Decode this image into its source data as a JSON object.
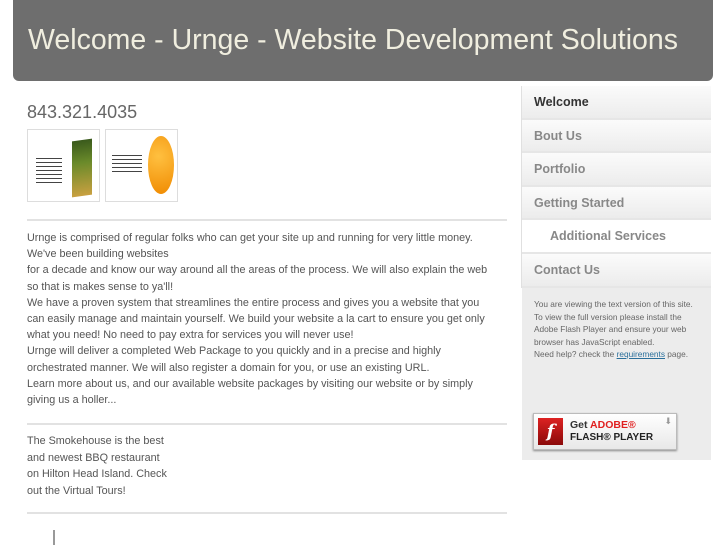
{
  "header": {
    "title": "Welcome - Urnge - Website Development Solutions"
  },
  "main": {
    "phone": "843.321.4035",
    "intro_lines": [
      "Urnge is comprised of regular folks who can get your site up and running for very little money.",
      "We've been building websites",
      "for a decade and know our way around all the areas of the process. We will also explain the web",
      "so that is makes sense to ya'll!",
      "We have a proven system that streamlines the entire process and gives you a website that you",
      "can easily manage and maintain yourself. We build your website a la cart to ensure you get only",
      "what you need! No need to pay extra for services you will never use!",
      "Urnge will deliver a completed Web Package to you quickly and in a precise and highly",
      "orchestrated manner. We will also register a domain for you, or use an existing URL.",
      "Learn more about us, and our available website packages by visiting our website or by simply",
      "giving us a holler..."
    ],
    "smokehouse_lines": [
      "The Smokehouse is the best",
      "and newest BBQ restaurant",
      "on Hilton Head Island. Check",
      "out the Virtual Tours!"
    ]
  },
  "nav": {
    "items": [
      {
        "label": "Welcome"
      },
      {
        "label": "Bout Us"
      },
      {
        "label": "Portfolio"
      },
      {
        "label": "Getting Started"
      },
      {
        "label": "Additional Services"
      },
      {
        "label": "Contact Us"
      }
    ]
  },
  "notice": {
    "line1": "You are viewing the text version of this site.",
    "line2": "To view the full version please install the Adobe Flash Player and ensure your web browser has JavaScript enabled.",
    "line3_pre": "Need help? check the ",
    "link": "requirements",
    "line3_post": " page."
  },
  "flash_button": {
    "get": "Get ",
    "adobe": "ADOBE®",
    "player": "FLASH® PLAYER",
    "logo": "f"
  }
}
